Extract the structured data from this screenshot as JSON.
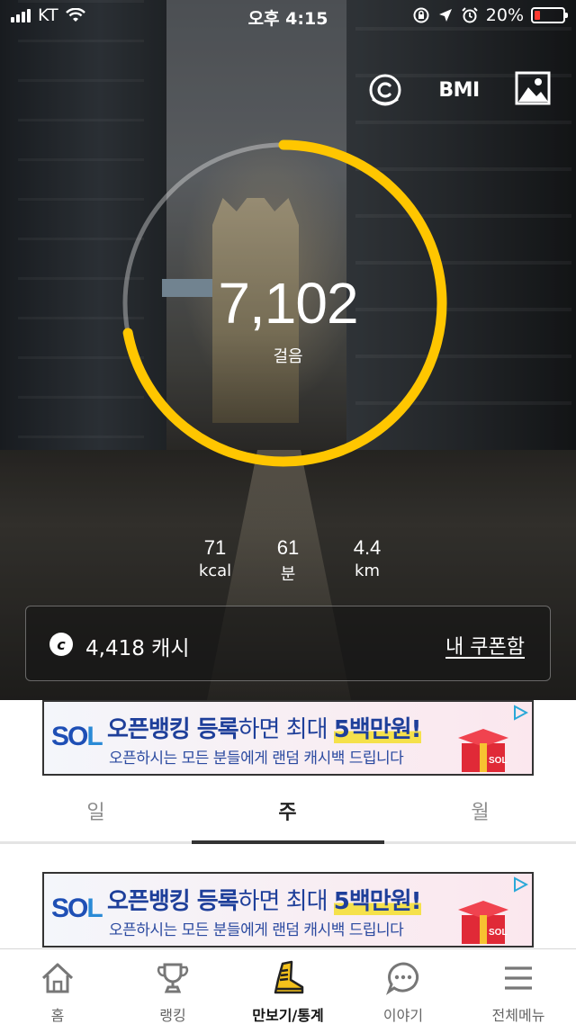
{
  "status_bar": {
    "carrier": "KT",
    "time": "오후 4:15",
    "battery_percent": "20%",
    "battery_level": 0.2,
    "battery_color": "#ff3b30"
  },
  "top_actions": {
    "cash_icon": "cash-coin-icon",
    "bmi_label": "BMI",
    "photo_icon": "photo-icon"
  },
  "pedometer": {
    "steps": "7,102",
    "steps_label": "걸음",
    "goal_progress": 0.72,
    "ring_color": "#ffc600",
    "ring_track_color": "rgba(255,255,255,0.35)"
  },
  "stats": [
    {
      "value": "71",
      "unit": "kcal"
    },
    {
      "value": "61",
      "unit": "분"
    },
    {
      "value": "4.4",
      "unit": "km"
    }
  ],
  "cash": {
    "coin_symbol": "c",
    "amount_text": "4,418 캐시",
    "coupon_link": "내 쿠폰함"
  },
  "banner_ad": {
    "logo_s": "S",
    "logo_o": "O",
    "logo_l": "L",
    "headline_part1": "오픈뱅킹 ",
    "headline_part2": "등록",
    "headline_part3": "하면 최대 ",
    "headline_part4": "5백만원!",
    "subline": "오픈하시는 모든 분들에게 랜덤 캐시백 드립니다",
    "gift_logo": "SOL"
  },
  "period_tabs": {
    "items": [
      "일",
      "주",
      "월"
    ],
    "selected_index": 1
  },
  "bottom_nav": {
    "items": [
      {
        "label": "홈",
        "icon": "home-icon"
      },
      {
        "label": "랭킹",
        "icon": "trophy-icon"
      },
      {
        "label": "만보기/통계",
        "icon": "shoe-icon"
      },
      {
        "label": "이야기",
        "icon": "chat-icon"
      },
      {
        "label": "전체메뉴",
        "icon": "menu-icon"
      }
    ],
    "selected_index": 2
  }
}
